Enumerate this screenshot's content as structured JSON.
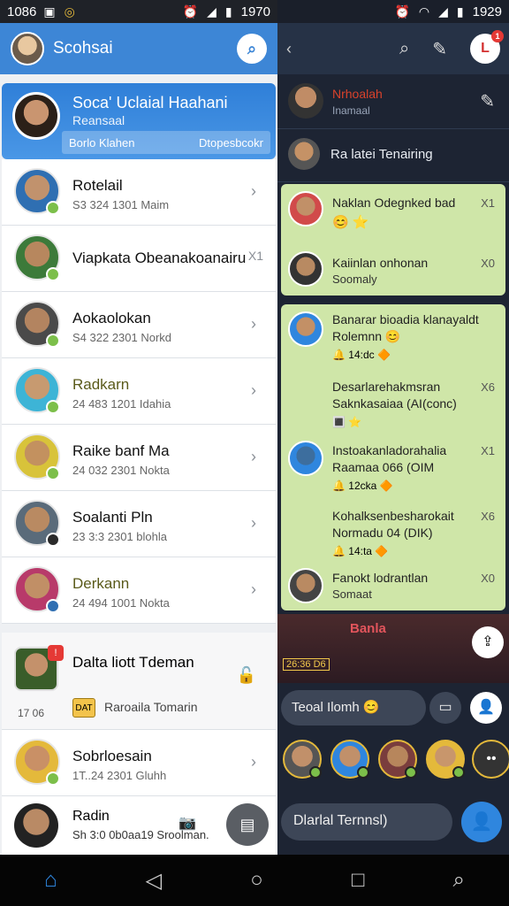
{
  "status": {
    "left_time": "1086",
    "left_clock": "1970",
    "right_time": "1929"
  },
  "left": {
    "header_title": "Scohsai",
    "highlight": {
      "name": "Soca' Uclaial Haahani",
      "sub": "Reansaal",
      "strip_left": "Borlo Klahen",
      "strip_right": "Dtopesbcokr"
    },
    "contacts": [
      {
        "name": "Rotelail",
        "sub": "S3 324 1301 Maim",
        "color": "#2f6fb2",
        "dot": "#7cbf4a"
      },
      {
        "name": "Viapkata Obeanakoanairu",
        "sub": "",
        "color": "#3c7a3a",
        "dot": "#7cbf4a",
        "extra": "X1"
      },
      {
        "name": "Aokaolokan",
        "sub": "S4 322 2301 Norkd",
        "color": "#4a4a4a",
        "dot": "#7cbf4a"
      },
      {
        "name": "Radkarn",
        "sub": "24 483 1201 Idahia",
        "color": "#3db4d6",
        "dot": "#7cbf4a"
      },
      {
        "name": "Raike banf Ma",
        "sub": "24 032 2301 Nokta",
        "color": "#d8c33a",
        "dot": "#7cbf4a"
      },
      {
        "name": "Soalanti Pln",
        "sub": "23 3:3 2301 blohla",
        "color": "#5a6b7a",
        "dot": "#2a2a2a"
      },
      {
        "name": "Derkann",
        "sub": "24 494 1001 Nokta",
        "color": "#b83a6a",
        "dot": "#2f6fb2"
      }
    ],
    "group": {
      "name": "Dalta liott Tdeman",
      "time": "17 06",
      "tag": "DAT",
      "msg": "Raroaila Tomarin"
    },
    "extra_contact": {
      "name": "Sobrloesain",
      "sub": "1T..24 2301 Gluhh"
    },
    "bottom_contact": {
      "name": "Radin",
      "sub": "Sh 3:0 0b0aa19 Sroolman."
    }
  },
  "right": {
    "top": {
      "name": "Nrhoalah",
      "sub": "Inamaal"
    },
    "section": "Ra latei Tenairing",
    "card1": [
      {
        "name": "Naklan Odegnked bad",
        "num": "X1",
        "emoji": "😊 ⭐"
      },
      {
        "name": "Kaiinlan onhonan",
        "sub": "Soomaly",
        "num": "X0"
      }
    ],
    "card2": [
      {
        "name": "Banarar bioadia klanayaldt",
        "name2": "Rolemnn 😊",
        "num": "",
        "emoji": "🔔 14:dc 🔶"
      },
      {
        "name": "Desarlarehakmsran",
        "name2": "Saknkasaiaa (AI(conc)",
        "num": "X6",
        "emoji": "🔳 ⭐"
      },
      {
        "name": "Instoakanladorahalia",
        "name2": "Raamaa 066 (OIM",
        "num": "X1",
        "emoji": "🔔 12cka 🔶"
      },
      {
        "name": "Kohalksenbesharokait",
        "name2": "Normadu 04 (DIK)",
        "num": "X6",
        "emoji": "🔔 14:ta 🔶"
      },
      {
        "name": "Fanokt lodrantlan",
        "name2": "Somaat",
        "num": "X0"
      }
    ],
    "video_label": "Banla",
    "video_time": "26:36 D6",
    "input_text": "Teoal Ilomh 😊",
    "compose_text": "Dlarlal Ternnsl)"
  },
  "colors": {
    "left_header": "#3d86d6",
    "right_bg": "#1d2433",
    "card": "#cfe6a8"
  }
}
